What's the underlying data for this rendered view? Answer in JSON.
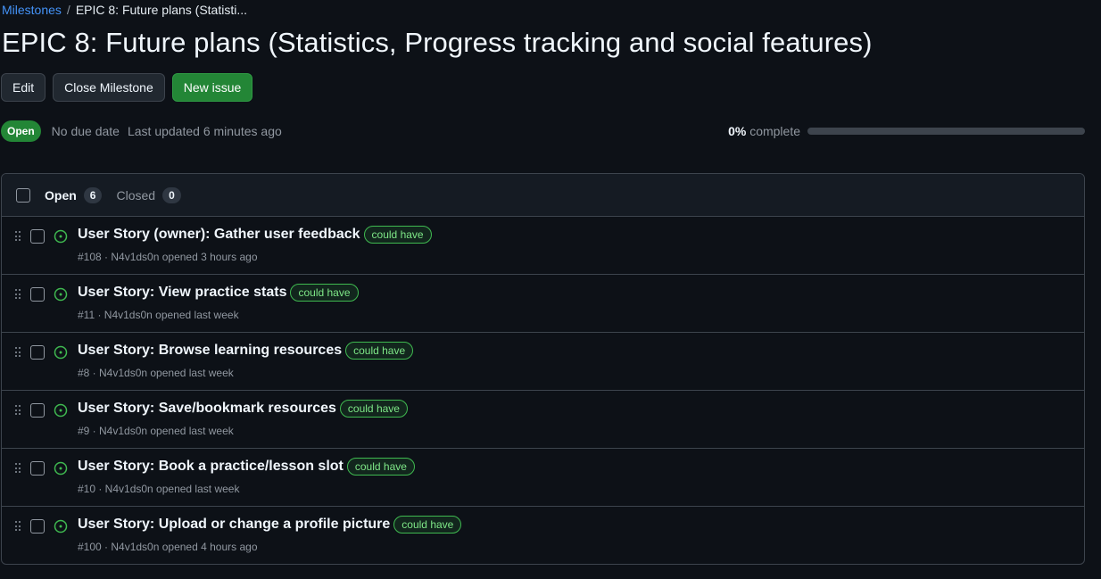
{
  "breadcrumb": {
    "parent": "Milestones",
    "separator": "/",
    "current": "EPIC 8: Future plans (Statisti..."
  },
  "title": "EPIC 8: Future plans (Statistics, Progress tracking and social features)",
  "actions": {
    "edit": "Edit",
    "close": "Close Milestone",
    "new_issue": "New issue"
  },
  "meta": {
    "state": "Open",
    "due": "No due date",
    "updated": "Last updated 6 minutes ago",
    "percent": "0%",
    "complete_label": "complete",
    "progress_fraction": 0
  },
  "tabs": {
    "open_label": "Open",
    "open_count": "6",
    "closed_label": "Closed",
    "closed_count": "0"
  },
  "issues": [
    {
      "title": "User Story (owner): Gather user feedback",
      "label": "could have",
      "meta": "#108 · N4v1ds0n opened 3 hours ago"
    },
    {
      "title": "User Story: View practice stats",
      "label": "could have",
      "meta": "#11 · N4v1ds0n opened last week"
    },
    {
      "title": "User Story: Browse learning resources",
      "label": "could have",
      "meta": "#8 · N4v1ds0n opened last week"
    },
    {
      "title": "User Story: Save/bookmark resources",
      "label": "could have",
      "meta": "#9 · N4v1ds0n opened last week"
    },
    {
      "title": "User Story: Book a practice/lesson slot",
      "label": "could have",
      "meta": "#10 · N4v1ds0n opened last week"
    },
    {
      "title": "User Story: Upload or change a profile picture",
      "label": "could have",
      "meta": "#100 · N4v1ds0n opened 4 hours ago"
    }
  ],
  "colors": {
    "accent_link": "#4493f8",
    "open_green": "#238636",
    "label_green": "#3fb950",
    "background": "#0d1117"
  }
}
